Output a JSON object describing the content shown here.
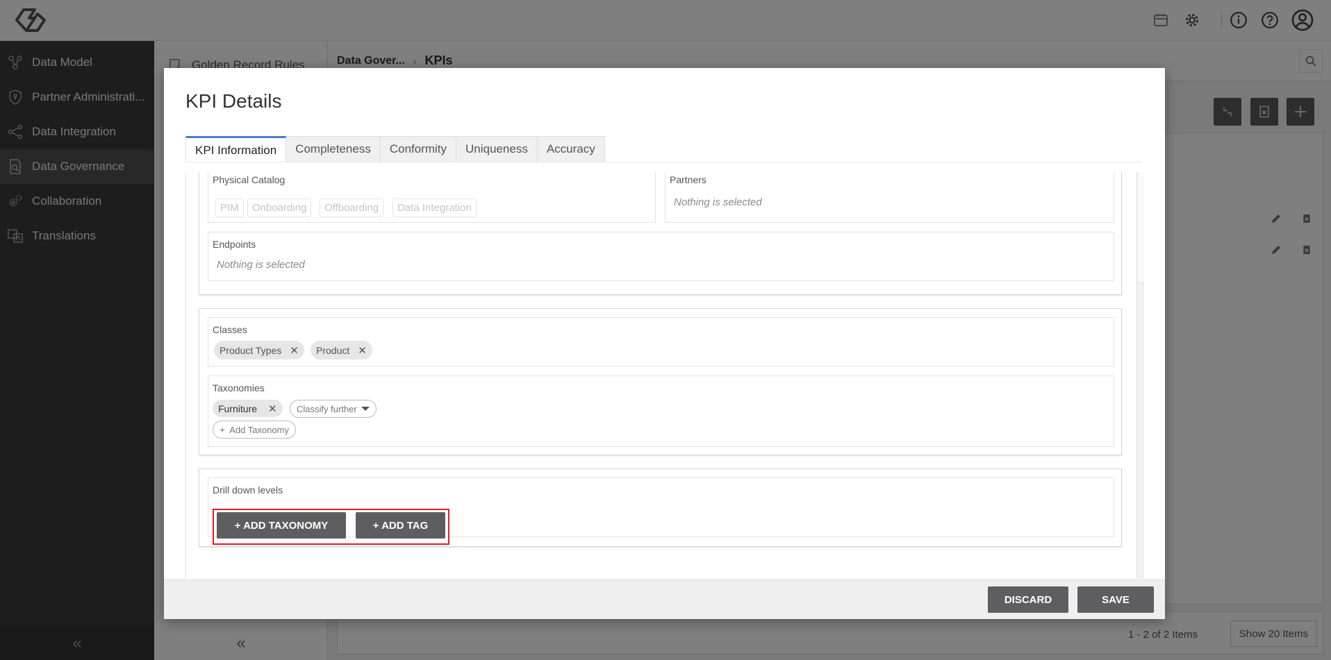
{
  "sidebar": {
    "items": [
      {
        "label": "Data Model",
        "icon": "data-model-icon",
        "active": false
      },
      {
        "label": "Partner Administrati...",
        "icon": "shield-icon",
        "active": false
      },
      {
        "label": "Data Integration",
        "icon": "share-nodes-icon",
        "active": false
      },
      {
        "label": "Data Governance",
        "icon": "document-search-icon",
        "active": true
      },
      {
        "label": "Collaboration",
        "icon": "gears-icon",
        "active": false
      },
      {
        "label": "Translations",
        "icon": "translate-icon",
        "active": false
      }
    ],
    "collapse_glyph": "«"
  },
  "subnav": {
    "item_label": "Golden Record Rules",
    "collapse_glyph": "«"
  },
  "breadcrumb": {
    "parent": "Data Gover...",
    "separator": "›",
    "current": "KPIs"
  },
  "pager": {
    "info": "1 - 2 of 2 Items",
    "page_size": "Show 20 Items"
  },
  "modal": {
    "title": "KPI Details",
    "tabs": [
      "KPI Information",
      "Completeness",
      "Conformity",
      "Uniqueness",
      "Accuracy"
    ],
    "active_tab": "KPI Information",
    "physical_catalog": {
      "label": "Physical Catalog",
      "options": [
        "PIM",
        "Onboarding",
        "Offboarding",
        "Data Integration"
      ]
    },
    "partners": {
      "label": "Partners",
      "value": "Nothing is selected"
    },
    "endpoints": {
      "label": "Endpoints",
      "value": "Nothing is selected"
    },
    "classes": {
      "label": "Classes",
      "chips": [
        "Product Types",
        "Product"
      ],
      "remove_glyph": "✕"
    },
    "taxonomies": {
      "label": "Taxonomies",
      "chip": "Furniture",
      "classify_further": "Classify further",
      "add_taxonomy": "Add Taxonomy",
      "add_glyph": "+"
    },
    "drill_down": {
      "label": "Drill down levels",
      "add_taxonomy_button": "+ ADD TAXONOMY",
      "add_tag_button": "+ ADD TAG"
    },
    "footer": {
      "discard": "DISCARD",
      "save": "SAVE"
    }
  },
  "colors": {
    "sidebar_bg": "#3b3b3b",
    "active_tab_accent": "#4a7fc1",
    "button_dark": "#5e5e60",
    "highlight_red": "#e01b24"
  }
}
